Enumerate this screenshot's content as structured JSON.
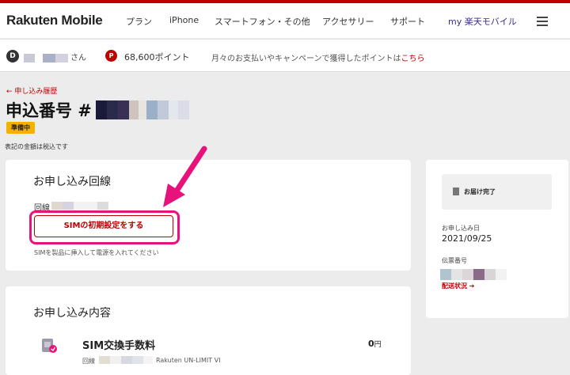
{
  "header": {
    "logo": "Rakuten Mobile",
    "nav": [
      "プラン",
      "iPhone",
      "スマートフォン・その他",
      "アクセサリー",
      "サポート"
    ],
    "my_page": "my 楽天モバイル"
  },
  "user_bar": {
    "rank_icon": "diamond-rank-icon",
    "honorific": "さん",
    "point_icon": "P",
    "points": "68,600ポイント",
    "promo_text": "月々のお支払いやキャンペーンで獲得したポイントは",
    "promo_link": "こちら"
  },
  "order": {
    "back_link": "← 申し込み履歴",
    "title": "申込番号 #",
    "status": "準備中",
    "tax_note": "表記の金額は税込です"
  },
  "line_card": {
    "title": "お申し込み回線",
    "line_label": "回線",
    "sim_button": "SIMの初期設定をする",
    "sim_note": "SIMを製品に挿入して電源を入れてください"
  },
  "side_card": {
    "status": "お届け完了",
    "date_label": "お申し込み日",
    "date": "2021/09/25",
    "slip_label": "伝票番号",
    "shipping_link": "配送状況 ➔"
  },
  "details_card": {
    "title": "お申し込み内容",
    "item_name": "SIM交換手数料",
    "item_price": "0",
    "item_price_unit": "円",
    "item_line_label": "回線",
    "item_plan": "Rakuten UN-LIMIT VI"
  },
  "colors": {
    "brand": "#bf0000",
    "highlight": "#e8127c",
    "badge": "#f6b000"
  }
}
